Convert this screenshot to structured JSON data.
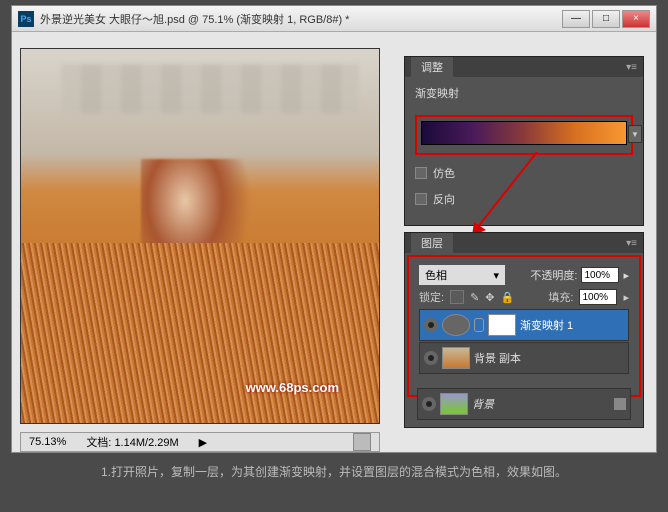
{
  "window": {
    "title": "外景逆光美女   大眼仔～旭.psd @ 75.1% (渐变映射 1, RGB/8#) *",
    "minimize": "—",
    "maximize": "□",
    "close": "×"
  },
  "canvas": {
    "watermark": "www.68ps.com"
  },
  "status": {
    "zoom": "75.13%",
    "doc_label": "文档:",
    "doc_size": "1.14M/2.29M",
    "arrow": "▶"
  },
  "adjust": {
    "tab": "调整",
    "title": "渐变映射",
    "dither": "仿色",
    "reverse": "反向"
  },
  "layers": {
    "tab": "图层",
    "blend_mode": "色相",
    "opacity_label": "不透明度:",
    "opacity_value": "100%",
    "lock_label": "锁定:",
    "fill_label": "填充:",
    "fill_value": "100%",
    "items": [
      {
        "name": "渐变映射 1"
      },
      {
        "name": "背景 副本"
      },
      {
        "name": "背景"
      }
    ]
  },
  "instruction": "1.打开照片，复制一层，为其创建渐变映射，并设置图层的混合模式为色相，效果如图。"
}
